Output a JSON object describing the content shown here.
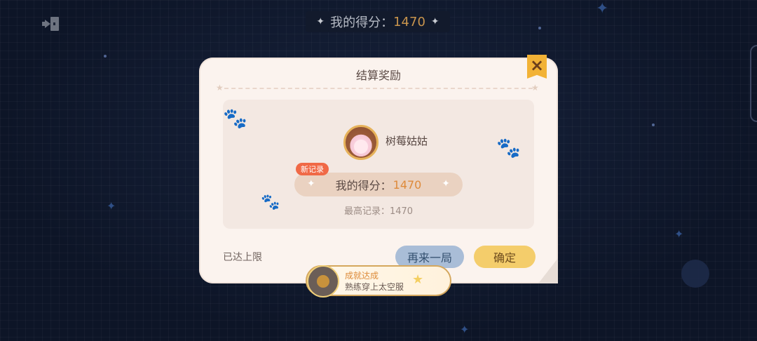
{
  "top_bar": {
    "score_label": "我的得分：",
    "score_value": "1470"
  },
  "modal": {
    "title": "结算奖励",
    "player_name": "树莓姑姑",
    "new_record_badge": "新记录",
    "score_label": "我的得分：",
    "score_value": "1470",
    "best_record": "最高记录：1470",
    "limit_text": "已达上限",
    "retry_button": "再来一局",
    "confirm_button": "确定"
  },
  "achievement": {
    "title": "成就达成",
    "name": "熟练穿上太空服"
  },
  "icons": {
    "exit": "exit-icon",
    "close": "close-icon",
    "sparkle": "sparkle-icon",
    "medal": "medal-icon"
  },
  "colors": {
    "background": "#0d1527",
    "accent_orange": "#de8a3a",
    "confirm_button": "#f4cd6b",
    "retry_button": "#a9bdd7",
    "badge_red": "#f06946"
  }
}
